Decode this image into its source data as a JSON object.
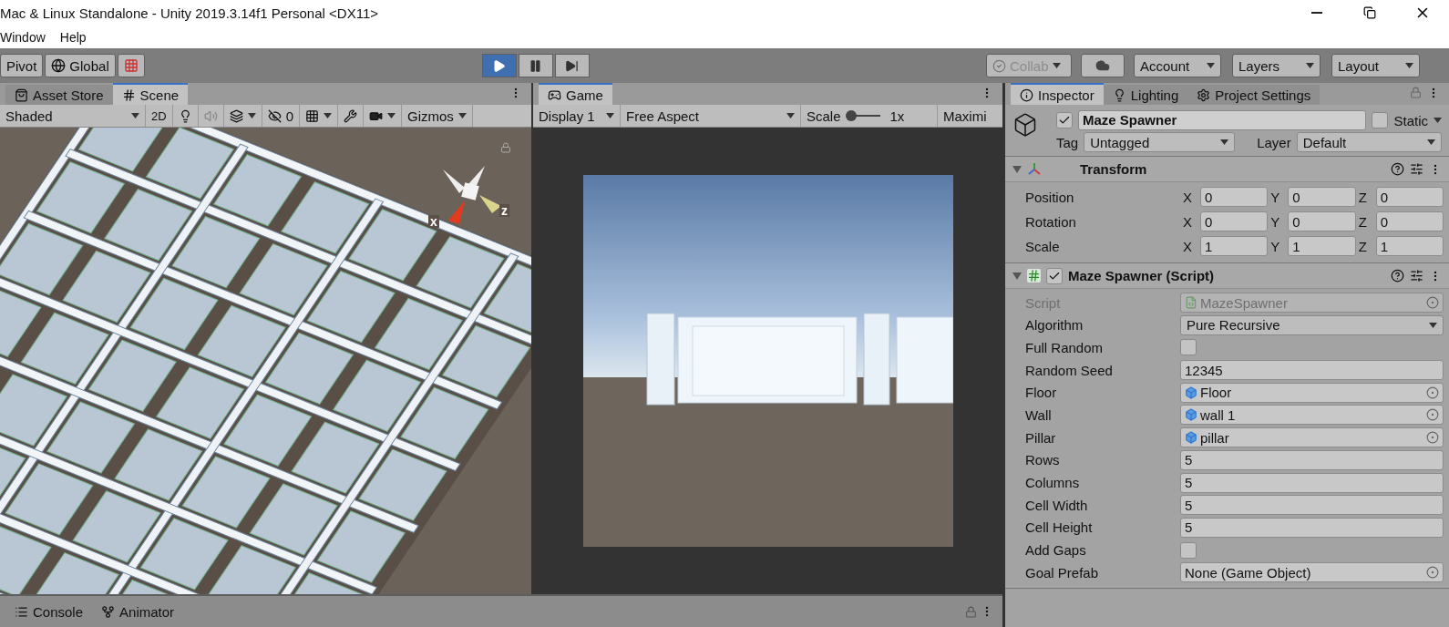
{
  "title_bar": {
    "title": "Mac & Linux Standalone - Unity 2019.3.14f1 Personal <DX11>"
  },
  "menu": [
    "Window",
    "Help"
  ],
  "toolbar": {
    "pivot": "Pivot",
    "global": "Global",
    "play_controls": [
      {
        "kind": "play",
        "selected": true
      },
      {
        "kind": "pause",
        "selected": false
      },
      {
        "kind": "step",
        "selected": false
      }
    ],
    "collab": {
      "label": "Collab",
      "disabled": true
    },
    "account": "Account",
    "layers": "Layers",
    "layout": "Layout"
  },
  "scene_panel": {
    "tabs": [
      {
        "label": "Asset Store",
        "kind": "store",
        "selected": false
      },
      {
        "label": "Scene",
        "kind": "scene",
        "selected": true
      }
    ],
    "shading": "Shaded",
    "mode_2d": "2D",
    "hidden_count": "0",
    "gizmos": "Gizmos",
    "axis_labels": [
      "x",
      "z"
    ]
  },
  "game_panel": {
    "tab": {
      "label": "Game",
      "selected": true
    },
    "display": "Display 1",
    "aspect": "Free Aspect",
    "scale_label": "Scale",
    "scale": {
      "level": 0
    },
    "scale_value": "1x",
    "maximize": "Maximi"
  },
  "inspector": {
    "tabs": [
      {
        "label": "Inspector",
        "kind": "info",
        "selected": true
      },
      {
        "label": "Lighting",
        "kind": "light",
        "selected": false
      },
      {
        "label": "Project Settings",
        "kind": "gear",
        "selected": false
      }
    ],
    "object": {
      "name": "Maze Spawner",
      "active": true,
      "static_label": "Static",
      "static": false,
      "tag_label": "Tag",
      "tag": "Untagged",
      "layer_label": "Layer",
      "layer": "Default"
    },
    "transform": {
      "title": "Transform",
      "expanded": true,
      "rows": [
        {
          "label": "Position",
          "axes": [
            "X",
            "Y",
            "Z"
          ],
          "values": [
            "0",
            "0",
            "0"
          ]
        },
        {
          "label": "Rotation",
          "axes": [
            "X",
            "Y",
            "Z"
          ],
          "values": [
            "0",
            "0",
            "0"
          ]
        },
        {
          "label": "Scale",
          "axes": [
            "X",
            "Y",
            "Z"
          ],
          "values": [
            "1",
            "1",
            "1"
          ]
        }
      ]
    },
    "script": {
      "title": "Maze Spawner (Script)",
      "expanded": true,
      "enabled": true,
      "fields": [
        {
          "kind": "script_ref",
          "label": "Script",
          "value": "MazeSpawner",
          "disabled": true
        },
        {
          "kind": "dropdown",
          "label": "Algorithm",
          "value": "Pure Recursive",
          "disabled": false
        },
        {
          "kind": "checkbox",
          "label": "Full Random",
          "checked": false,
          "disabled": false
        },
        {
          "kind": "text",
          "label": "Random Seed",
          "value": "12345",
          "disabled": false
        },
        {
          "kind": "prefab_ref",
          "label": "Floor",
          "value": "Floor",
          "disabled": false
        },
        {
          "kind": "prefab_ref",
          "label": "Wall",
          "value": "wall 1",
          "disabled": false
        },
        {
          "kind": "prefab_ref",
          "label": "Pillar",
          "value": "pillar",
          "disabled": false
        },
        {
          "kind": "text",
          "label": "Rows",
          "value": "5",
          "disabled": false
        },
        {
          "kind": "text",
          "label": "Columns",
          "value": "5",
          "disabled": false
        },
        {
          "kind": "text",
          "label": "Cell Width",
          "value": "5",
          "disabled": false
        },
        {
          "kind": "text",
          "label": "Cell Height",
          "value": "5",
          "disabled": false
        },
        {
          "kind": "checkbox",
          "label": "Add Gaps",
          "checked": false,
          "disabled": false
        },
        {
          "kind": "object_ref",
          "label": "Goal Prefab",
          "value": "None (Game Object)",
          "disabled": false
        }
      ]
    }
  },
  "bottom_tabs": [
    {
      "label": "Console",
      "kind": "console"
    },
    {
      "label": "Animator",
      "kind": "animator"
    }
  ]
}
